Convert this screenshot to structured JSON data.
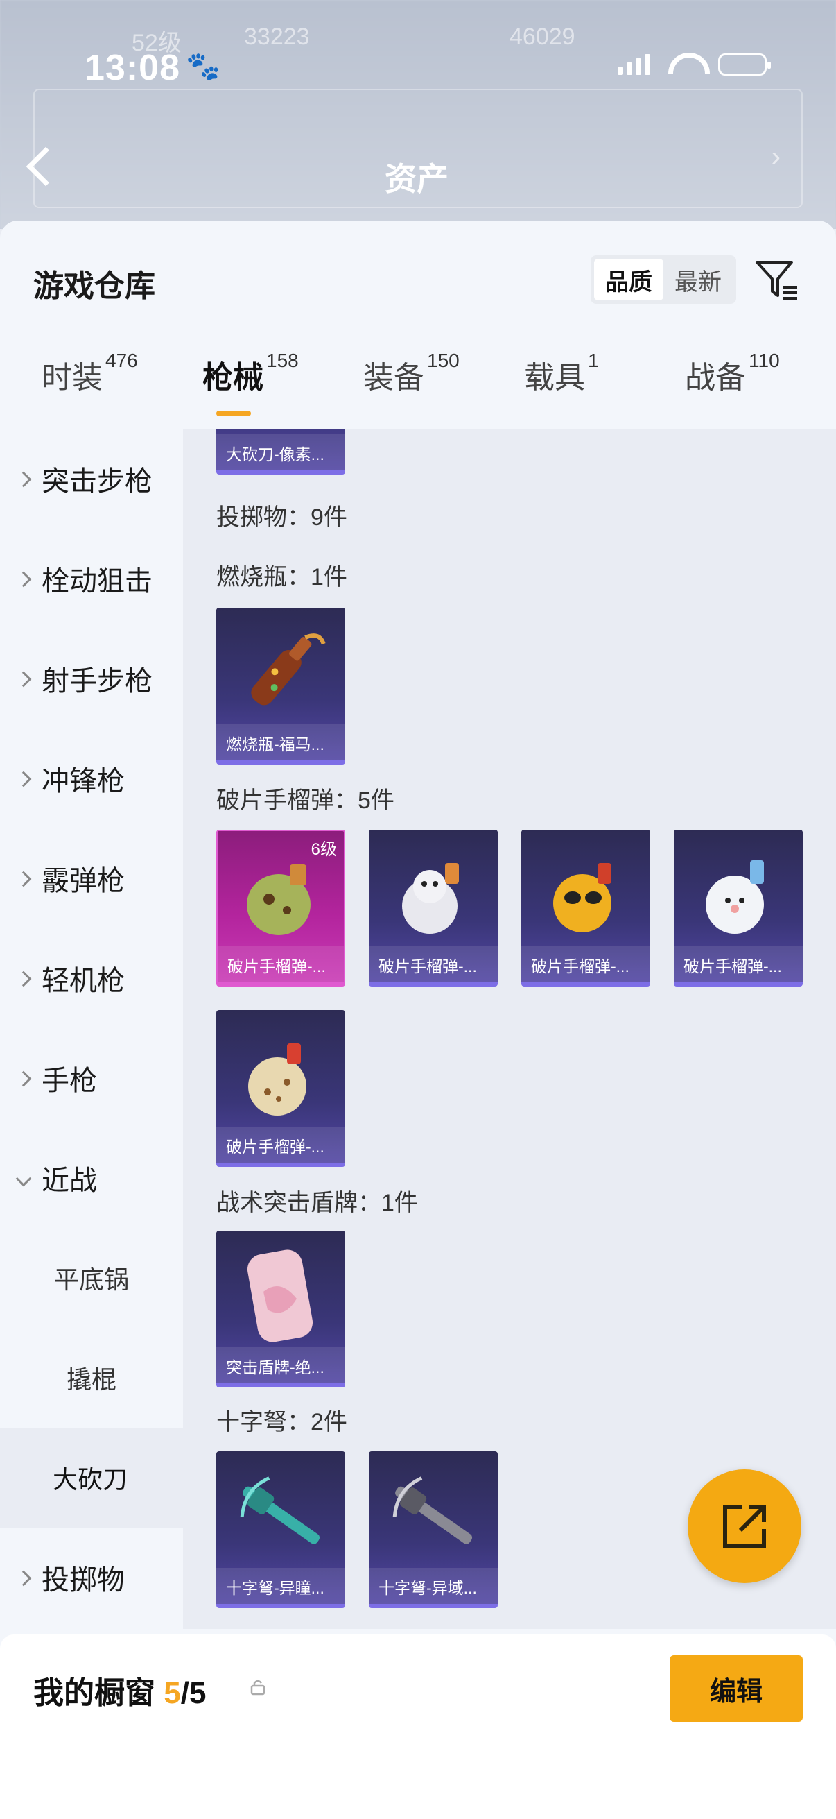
{
  "status_bar": {
    "time": "13:08"
  },
  "header": {
    "title": "资产",
    "bg_stats": [
      "52级",
      "33223",
      "46029"
    ]
  },
  "warehouse": {
    "title": "游戏仓库",
    "sort": {
      "options": [
        "品质",
        "最新"
      ],
      "selected": "品质"
    }
  },
  "tabs": [
    {
      "label": "时装",
      "count": "476"
    },
    {
      "label": "枪械",
      "count": "158",
      "active": true
    },
    {
      "label": "装备",
      "count": "150"
    },
    {
      "label": "载具",
      "count": "1"
    },
    {
      "label": "战备",
      "count": "110"
    }
  ],
  "sidebar": {
    "items": [
      {
        "label": "突击步枪"
      },
      {
        "label": "栓动狙击"
      },
      {
        "label": "射手步枪"
      },
      {
        "label": "冲锋枪"
      },
      {
        "label": "霰弹枪"
      },
      {
        "label": "轻机枪"
      },
      {
        "label": "手枪"
      },
      {
        "label": "近战"
      },
      {
        "label": "平底锅"
      },
      {
        "label": "撬棍"
      },
      {
        "label": "大砍刀"
      },
      {
        "label": "投掷物"
      }
    ]
  },
  "content": {
    "top_card": "大砍刀-像素...",
    "throwables_header": "投掷物：9件",
    "sections": [
      {
        "title": "燃烧瓶：1件",
        "cards": [
          "燃烧瓶-福马..."
        ]
      },
      {
        "title": "破片手榴弹：5件",
        "cards": [
          "破片手榴弹-...",
          "破片手榴弹-...",
          "破片手榴弹-...",
          "破片手榴弹-...",
          "破片手榴弹-..."
        ],
        "first_level": "6级"
      },
      {
        "title": "战术突击盾牌：1件",
        "cards": [
          "突击盾牌-绝..."
        ]
      },
      {
        "title": "十字弩：2件",
        "cards": [
          "十字弩-异瞳...",
          "十字弩-异域..."
        ]
      }
    ]
  },
  "footer": {
    "title": "我的橱窗",
    "count_current": "5",
    "count_total": "/5",
    "edit_label": "编辑"
  },
  "colors": {
    "accent": "#f5a623",
    "card_purple": "#3a3678",
    "card_gold": "#b3249d"
  }
}
